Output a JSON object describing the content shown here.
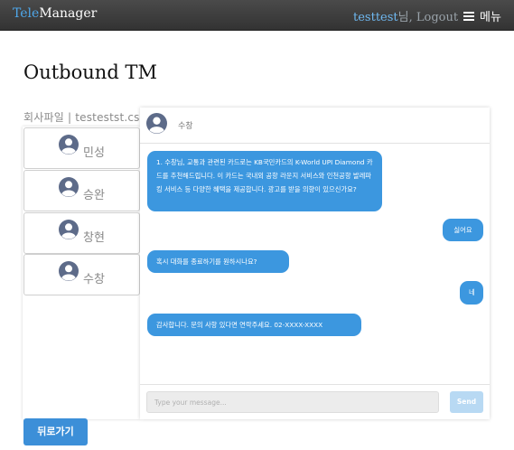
{
  "navbar": {
    "brand_part1": "Tele",
    "brand_part2": "Manager",
    "user_name": "testtest",
    "user_suffix": "님,",
    "logout": "Logout",
    "menu_label": "메뉴"
  },
  "page": {
    "title": "Outbound TM",
    "file_label": "회사파일 | testestst.csv"
  },
  "contacts": [
    {
      "name": "민성"
    },
    {
      "name": "승완"
    },
    {
      "name": "창현"
    },
    {
      "name": "수창"
    }
  ],
  "chat": {
    "header_name": "수창",
    "messages": [
      {
        "side": "left",
        "text": "1. 수창님, 교통과 관련된 카드로는 KB국민카드의 K-World UPI Diamond 카드를 추천해드립니다. 이 카드는 국내외 공항 라운지 서비스와 인천공항 발레파킹 서비스 등 다양한 혜택을 제공합니다. 광고를 받을 의향이 있으신가요?"
      },
      {
        "side": "right",
        "text": "싫어요"
      },
      {
        "side": "left",
        "text": "혹시 대화를 종료하기를 원하시나요?"
      },
      {
        "side": "right",
        "text": "네"
      },
      {
        "side": "left",
        "text": "감사합니다. 문의 사항 있다면 연락주세요. 02-XXXX-XXXX"
      }
    ],
    "input_placeholder": "Type your message...",
    "send_label": "Send"
  },
  "back_button": "뒤로가기",
  "colors": {
    "accent": "#3c97df",
    "navbar": "#3a3a3a",
    "send_disabled": "#b8d9f3"
  },
  "icons": {
    "avatar": "user-avatar-icon",
    "menu": "hamburger-icon"
  }
}
